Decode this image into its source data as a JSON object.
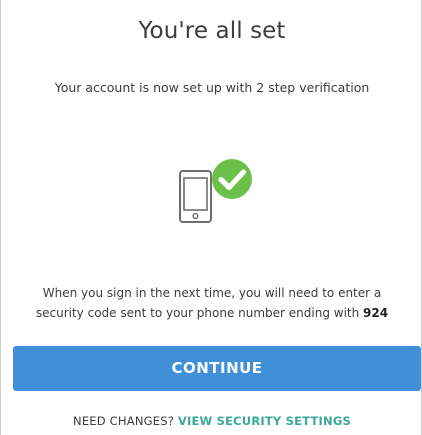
{
  "header": {
    "title": "You're all set"
  },
  "main": {
    "subtitle": "Your account is now set up with 2 step verification",
    "notice_line1": "When you sign in the next time, you will need to enter a",
    "notice_line2_prefix": "security code sent to your phone number ending with ",
    "phone_suffix": "924"
  },
  "icons": {
    "phone": "phone-icon",
    "check": "checkmark-badge-icon"
  },
  "actions": {
    "continue_label": "CONTINUE"
  },
  "footer": {
    "prefix": "NEED CHANGES? ",
    "link_label": "VIEW SECURITY SETTINGS"
  },
  "colors": {
    "primary_button": "#3f8fd9",
    "success_green": "#6cc04a",
    "link_teal": "#3aa89a",
    "text": "#3c3c3c"
  }
}
